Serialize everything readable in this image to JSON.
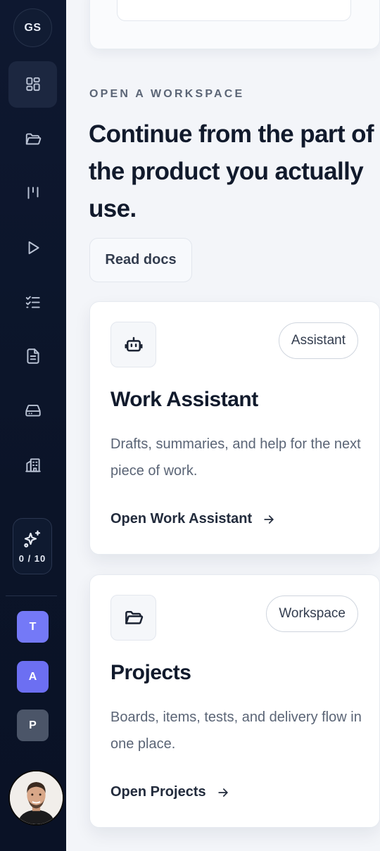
{
  "sidebar": {
    "user_initials": "GS",
    "nav_items": [
      {
        "icon": "dashboard-icon",
        "active": true
      },
      {
        "icon": "folder-icon",
        "active": false
      },
      {
        "icon": "board-columns-icon",
        "active": false
      },
      {
        "icon": "play-icon",
        "active": false
      },
      {
        "icon": "checklist-icon",
        "active": false
      },
      {
        "icon": "document-icon",
        "active": false
      },
      {
        "icon": "storage-drive-icon",
        "active": false
      },
      {
        "icon": "building-icon",
        "active": false
      }
    ],
    "ai_credits": {
      "icon": "sparkles-icon",
      "count": "0 / 10"
    },
    "workspaces": [
      {
        "label": "T",
        "color": "#7479f7"
      },
      {
        "label": "A",
        "color": "#6c6ff2"
      },
      {
        "label": "P",
        "color": "#4b5568"
      }
    ],
    "avatar": {
      "icon": "user-avatar"
    }
  },
  "main": {
    "eyebrow": "OPEN A WORKSPACE",
    "headline": "Continue from the part of the product you actually use.",
    "docs_button": "Read docs",
    "cards": [
      {
        "icon": "robot-icon",
        "badge": "Assistant",
        "title": "Work Assistant",
        "description": "Drafts, summaries, and help for the next piece of work.",
        "link": "Open Work Assistant"
      },
      {
        "icon": "folder-icon",
        "badge": "Workspace",
        "title": "Projects",
        "description": "Boards, items, tests, and delivery flow in one place.",
        "link": "Open Projects"
      }
    ]
  },
  "colors": {
    "sidebar_bg": "#0d1730",
    "page_bg": "#f3f5f9",
    "text_primary": "#111a2c",
    "text_muted": "#5b6576"
  }
}
